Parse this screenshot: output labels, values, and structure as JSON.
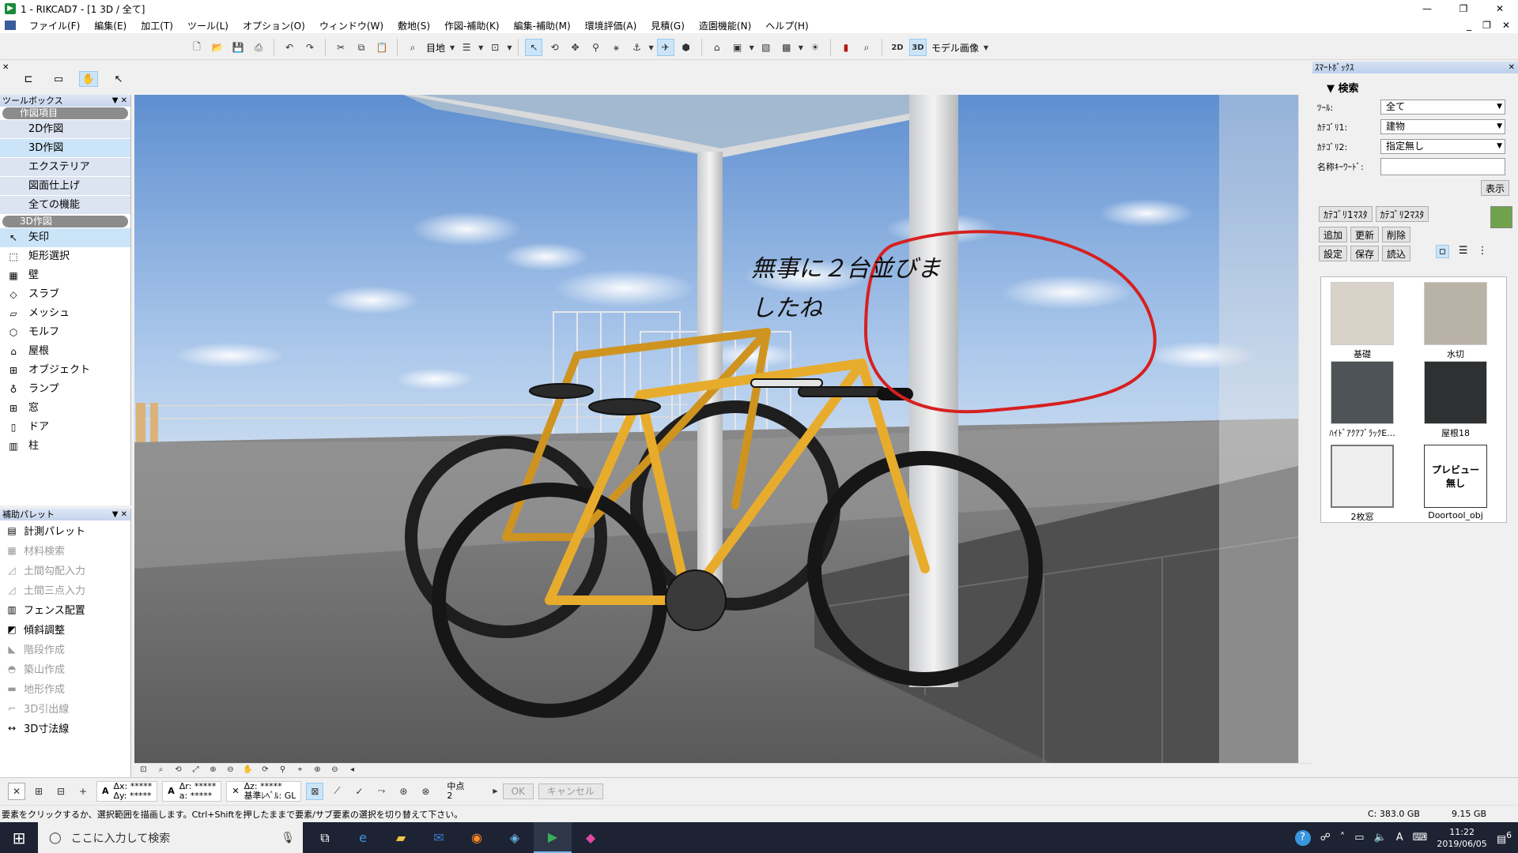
{
  "window": {
    "title": "1 - RIKCAD7 - [1 3D / 全て]",
    "minimize": "—",
    "maximize": "❐",
    "close": "✕"
  },
  "menu": {
    "items": [
      "ファイル(F)",
      "編集(E)",
      "加工(T)",
      "ツール(L)",
      "オプション(O)",
      "ウィンドウ(W)",
      "敷地(S)",
      "作図-補助(K)",
      "編集-補助(M)",
      "環境評価(A)",
      "見積(G)",
      "造園機能(N)",
      "ヘルプ(H)"
    ],
    "right": [
      "_",
      "❐",
      "✕"
    ]
  },
  "toolbar": {
    "view_label": "目地",
    "model_label": "モデル画像",
    "icons": [
      "new-file-icon",
      "open-folder-icon",
      "save-icon",
      "print-icon",
      "undo-icon",
      "redo-icon",
      "cut-icon",
      "copy-icon",
      "paste-icon",
      "find-icon"
    ]
  },
  "toolbox": {
    "title": "ツールボックス",
    "group1": "作図項目",
    "categories": [
      "2D作図",
      "3D作図",
      "エクステリア",
      "図面仕上げ",
      "全ての機能"
    ],
    "group2": "3D作図",
    "tools": [
      {
        "label": "矢印",
        "icon": "arrow-icon",
        "glyph": "↖"
      },
      {
        "label": "矩形選択",
        "icon": "marquee-icon",
        "glyph": "⬚"
      },
      {
        "label": "壁",
        "icon": "wall-icon",
        "glyph": "▦"
      },
      {
        "label": "スラブ",
        "icon": "slab-icon",
        "glyph": "◇"
      },
      {
        "label": "メッシュ",
        "icon": "mesh-icon",
        "glyph": "▱"
      },
      {
        "label": "モルフ",
        "icon": "morph-icon",
        "glyph": "⬡"
      },
      {
        "label": "屋根",
        "icon": "roof-icon",
        "glyph": "⌂"
      },
      {
        "label": "オブジェクト",
        "icon": "object-icon",
        "glyph": "⊞"
      },
      {
        "label": "ランプ",
        "icon": "lamp-icon",
        "glyph": "♁"
      },
      {
        "label": "窓",
        "icon": "window-icon",
        "glyph": "⊞"
      },
      {
        "label": "ドア",
        "icon": "door-icon",
        "glyph": "▯"
      },
      {
        "label": "柱",
        "icon": "column-icon",
        "glyph": "▥"
      }
    ]
  },
  "auxpalette": {
    "title": "補助パレット",
    "items": [
      {
        "label": "計測パレット",
        "enabled": true,
        "icon": "measure-icon",
        "glyph": "▤"
      },
      {
        "label": "材料検索",
        "enabled": false,
        "icon": "material-search-icon",
        "glyph": "▦"
      },
      {
        "label": "土間勾配入力",
        "enabled": false,
        "icon": "slope-input-icon",
        "glyph": "◿"
      },
      {
        "label": "土間三点入力",
        "enabled": false,
        "icon": "three-point-icon",
        "glyph": "◿"
      },
      {
        "label": "フェンス配置",
        "enabled": true,
        "icon": "fence-icon",
        "glyph": "▥"
      },
      {
        "label": "傾斜調整",
        "enabled": true,
        "icon": "incline-icon",
        "glyph": "◩"
      },
      {
        "label": "階段作成",
        "enabled": false,
        "icon": "stairs-icon",
        "glyph": "◣"
      },
      {
        "label": "築山作成",
        "enabled": false,
        "icon": "mound-icon",
        "glyph": "◓"
      },
      {
        "label": "地形作成",
        "enabled": false,
        "icon": "terrain-icon",
        "glyph": "▬"
      },
      {
        "label": "3D引出線",
        "enabled": false,
        "icon": "leader-icon",
        "glyph": "⌐"
      },
      {
        "label": "3D寸法線",
        "enabled": true,
        "icon": "dimension-icon",
        "glyph": "↔"
      }
    ]
  },
  "viewport": {
    "annotation": "無事に２台並びま\nしたね"
  },
  "smartbox": {
    "title": "ｽﾏｰﾄﾎﾞｯｸｽ",
    "section": "検索",
    "tool_label": "ﾂｰﾙ:",
    "tool_value": "全て",
    "cat1_label": "ｶﾃｺﾞﾘ1:",
    "cat1_value": "建物",
    "cat2_label": "ｶﾃｺﾞﾘ2:",
    "cat2_value": "指定無し",
    "keyword_label": "名称ｷｰﾜｰﾄﾞ:",
    "show_btn": "表示",
    "cat1_master": "ｶﾃｺﾞﾘ1ﾏｽﾀ",
    "cat2_master": "ｶﾃｺﾞﾘ2ﾏｽﾀ",
    "add": "追加",
    "update": "更新",
    "delete": "削除",
    "settings": "設定",
    "save": "保存",
    "load": "読込",
    "thumbs": [
      "基礎",
      "水切",
      "ﾊｲﾄﾞｱｸｱﾌﾞﾗｯｸE...",
      "屋根18",
      "2枚窓",
      "Doortool_obj"
    ],
    "preview_none": "プレビュー\n無し"
  },
  "inputbar": {
    "dx": "Δx: *****",
    "dy": "Δy: *****",
    "dr": "Δr: *****",
    "a": "a: *****",
    "dz": "Δz: *****",
    "base_level": "基準ﾚﾍﾞﾙ: GL",
    "midpoint": "中点",
    "midpoint_num": "2",
    "ok": "OK",
    "cancel": "キャンセル"
  },
  "status": {
    "message": "要素をクリックするか、選択範囲を描画します。Ctrl+Shiftを押したままで要素/サブ要素の選択を切り替えて下さい。",
    "disk1": "C: 383.0 GB",
    "disk2": "9.15 GB"
  },
  "taskbar": {
    "search": "ここに入力して検索",
    "time": "11:22",
    "date": "2019/06/05",
    "notif": "6",
    "ime": "A"
  },
  "colors": {
    "selection": "#cce4f7",
    "bike": "#e0a42a",
    "annotation_circle": "#d62020"
  }
}
